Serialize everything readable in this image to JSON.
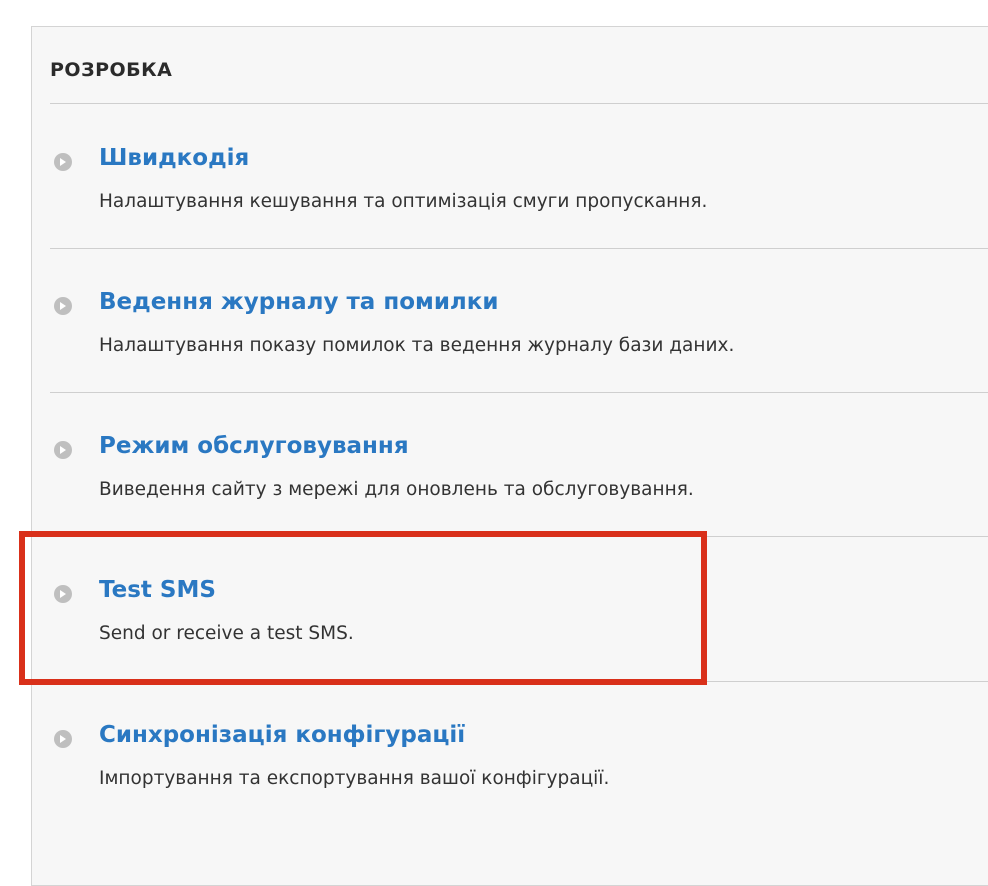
{
  "section": {
    "title": "РОЗРОБКА"
  },
  "items": [
    {
      "title": "Швидкодія",
      "description": "Налаштування кешування та оптимізація смуги пропускання."
    },
    {
      "title": "Ведення журналу та помилки",
      "description": "Налаштування показу помилок та ведення журналу бази даних."
    },
    {
      "title": "Режим обслуговування",
      "description": "Виведення сайту з мережі для оновлень та обслуговування."
    },
    {
      "title": "Test SMS",
      "description": "Send or receive a test SMS."
    },
    {
      "title": "Синхронізація конфігурації",
      "description": "Імпортування та експортування вашої конфігурації."
    }
  ],
  "colors": {
    "link": "#2a78c2",
    "highlight": "#d9301a",
    "panel_background": "#f7f7f7",
    "icon": "#bfbfbf"
  },
  "icons": {
    "item_icon": "chevron-right-circle-icon"
  }
}
